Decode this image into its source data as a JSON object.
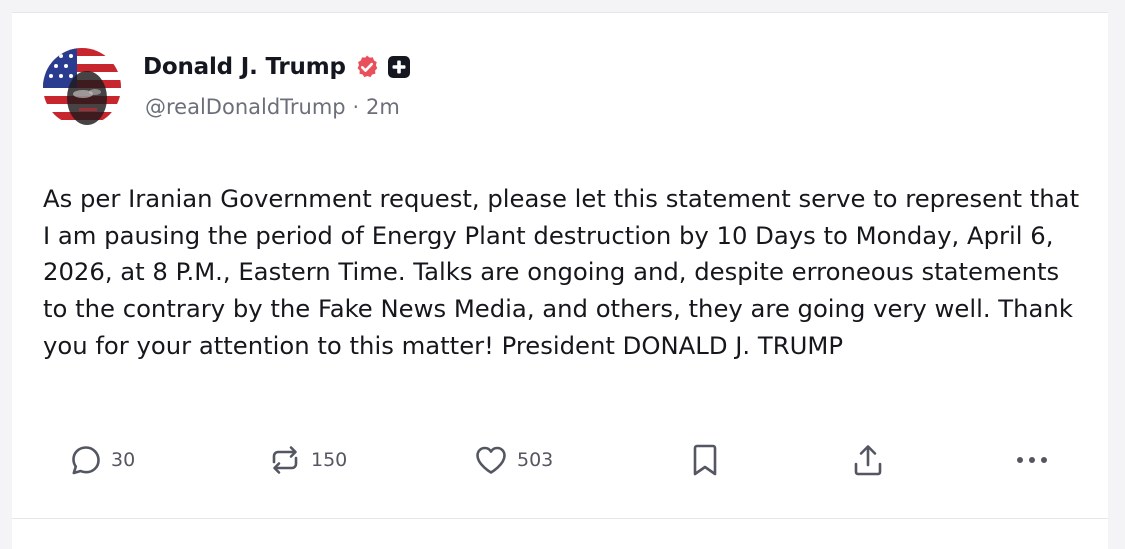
{
  "post": {
    "author": {
      "display_name": "Donald J. Trump",
      "handle": "@realDonaldTrump",
      "verified": true
    },
    "separator": "·",
    "time_ago": "2m",
    "text": "As per Iranian Government request, please let this statement serve to represent that I am pausing the period of Energy Plant destruction by 10 Days to Monday, April 6, 2026, at 8 P.M., Eastern Time. Talks are ongoing and, despite erroneous statements to the contrary by the Fake News Media, and others, they are going very well. Thank you for your attention to this matter! President DONALD J. TRUMP",
    "actions": {
      "replies": "30",
      "reposts": "150",
      "likes": "503"
    }
  },
  "icons": {
    "verified": "verified-badge-icon",
    "plus": "plus-badge-icon",
    "reply": "speech-bubble-icon",
    "repost": "repost-arrows-icon",
    "like": "heart-icon",
    "bookmark": "bookmark-icon",
    "share": "share-upload-icon",
    "more": "more-dots-icon"
  },
  "colors": {
    "verified_badge": "#e8505b",
    "text": "#15171c",
    "muted": "#6b6f7a",
    "icon": "#545762"
  }
}
